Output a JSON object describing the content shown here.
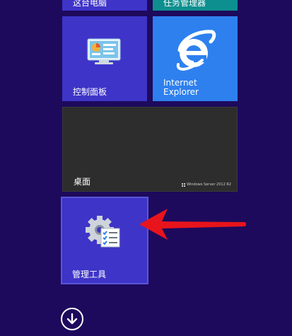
{
  "tiles": {
    "this_pc": {
      "label": "这台电脑"
    },
    "task_manager": {
      "label": "任务管理器"
    },
    "control_panel": {
      "label": "控制面板"
    },
    "internet_explorer": {
      "label": "Internet\nExplorer"
    },
    "desktop": {
      "label": "桌面",
      "brand": "Windows Server 2012 R2"
    },
    "admin_tools": {
      "label": "管理工具"
    }
  },
  "icons": {
    "control_panel": "control-panel-icon",
    "internet_explorer": "internet-explorer-icon",
    "admin_tools": "admin-tools-icon",
    "apps_down": "down-arrow-circle-icon",
    "pointer": "red-arrow-annotation"
  },
  "colors": {
    "background": "#1d0a5c",
    "tile_blue": "#3e34c8",
    "tile_teal": "#0d8f8f",
    "tile_ie": "#2e80ef",
    "tile_desktop": "#2d2d2d",
    "annotation_red": "#e8141b"
  }
}
